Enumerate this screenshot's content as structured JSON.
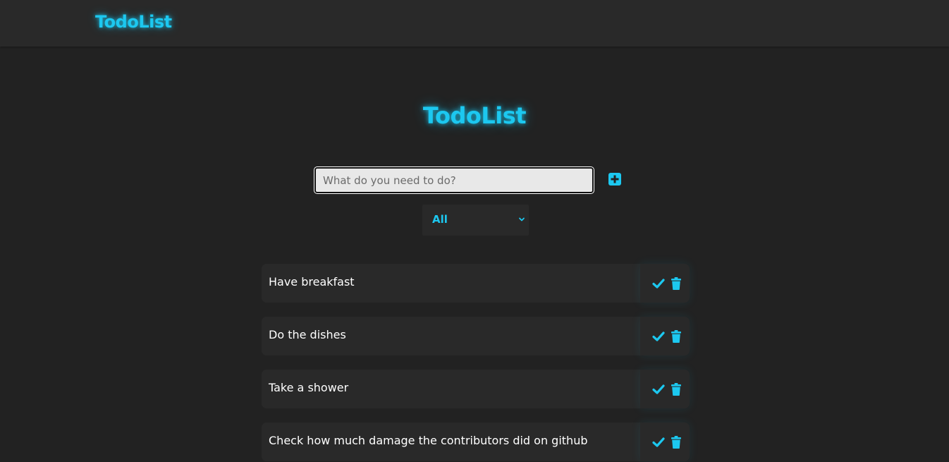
{
  "header": {
    "brand": "TodoList"
  },
  "main": {
    "title": "TodoList",
    "input": {
      "placeholder": "What do you need to do?",
      "value": ""
    },
    "add_icon": "plus-square-icon",
    "filter": {
      "selected": "All",
      "icon": "chevron-down-icon"
    },
    "todos": [
      {
        "text": "Have breakfast"
      },
      {
        "text": "Do the dishes"
      },
      {
        "text": "Take a shower"
      },
      {
        "text": "Check how much damage the contributors did on github"
      }
    ]
  },
  "colors": {
    "accent": "#1cc8f0",
    "background": "#222222",
    "surface": "#292929",
    "text": "#ffffff"
  }
}
